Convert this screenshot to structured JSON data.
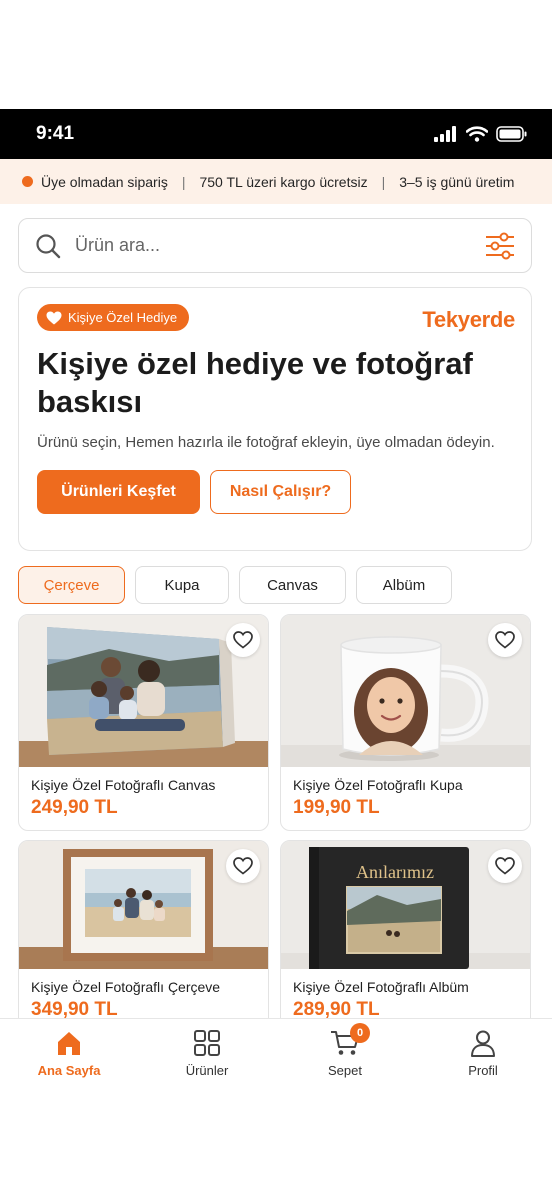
{
  "status": {
    "time": "9:41"
  },
  "promo": {
    "items": [
      "Üye olmadan sipariş",
      "750 TL üzeri kargo ücretsiz",
      "3–5 iş günü üretim"
    ],
    "separator": "|"
  },
  "search": {
    "placeholder": "Ürün ara...",
    "value": ""
  },
  "hero": {
    "badge": "Kişiye Özel Hediye",
    "brand": "Tekyerde",
    "title": "Kişiye özel hediye ve fotoğraf baskısı",
    "subtitle": "Ürünü seçin, Hemen hazırla ile fotoğraf ekleyin, üye olmadan ödeyin.",
    "primary_button": "Ürünleri Keşfet",
    "secondary_button": "Nasıl Çalışır?"
  },
  "categories": [
    {
      "label": "Çerçeve",
      "active": true
    },
    {
      "label": "Kupa",
      "active": false
    },
    {
      "label": "Canvas",
      "active": false
    },
    {
      "label": "Albüm",
      "active": false
    }
  ],
  "products": [
    {
      "title": "Kişiye Özel Fotoğraflı Canvas",
      "price": "249,90 TL"
    },
    {
      "title": "Kişiye Özel Fotoğraflı Kupa",
      "price": "199,90 TL"
    },
    {
      "title": "Kişiye Özel Fotoğraflı Çerçeve",
      "price": "349,90 TL"
    },
    {
      "title": "Kişiye Özel Fotoğraflı Albüm",
      "price": "289,90 TL",
      "cover_text": "Anılarımız"
    }
  ],
  "nav": {
    "items": [
      {
        "label": "Ana Sayfa",
        "icon": "home-icon",
        "active": true
      },
      {
        "label": "Ürünler",
        "icon": "grid-icon",
        "active": false
      },
      {
        "label": "Sepet",
        "icon": "cart-icon",
        "active": false,
        "badge": "0"
      },
      {
        "label": "Profil",
        "icon": "user-icon",
        "active": false
      }
    ]
  },
  "colors": {
    "accent": "#ee6b1e",
    "promo_bg": "#fdf1e8",
    "status_bar": "#000000"
  }
}
